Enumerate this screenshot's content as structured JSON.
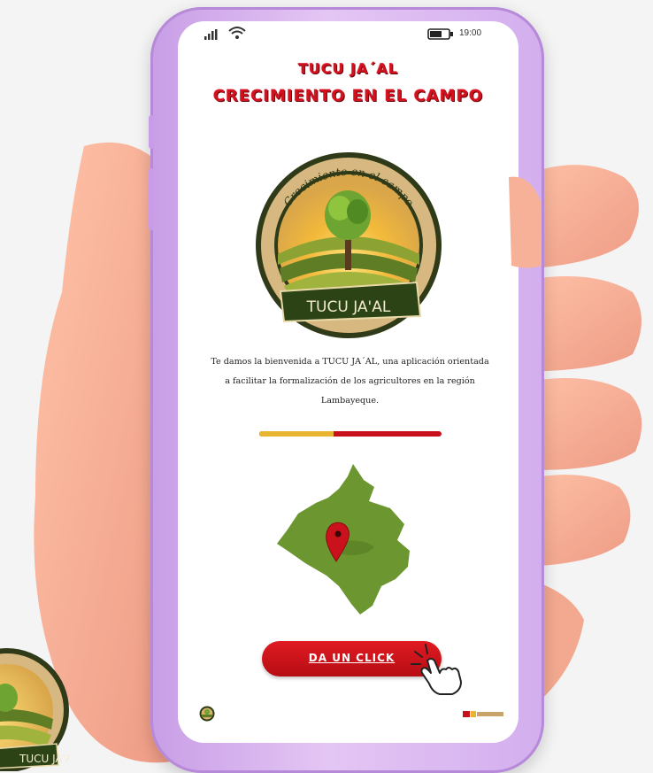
{
  "status_bar": {
    "time": "19:00",
    "icons": [
      "signal-icon",
      "wifi-icon",
      "battery-icon"
    ]
  },
  "header": {
    "line1": "TUCU JA´AL",
    "line2": "CRECIMIENTO EN EL CAMPO"
  },
  "logo": {
    "arc_text": "Crecimiento en el campo",
    "banner_text": "TUCU JA'AL"
  },
  "intro": {
    "line1": "Te damos la bienvenida a TUCU JA´AL, una aplicación orientada",
    "line2": "a facilitar la formalización de los agricultores en la región",
    "line3": "Lambayeque."
  },
  "progress": {
    "value_fraction": 0.41,
    "fill_color": "#e7b530",
    "track_color": "#c8111b"
  },
  "map": {
    "icons": [
      "lambayeque-map",
      "location-pin-icon"
    ],
    "fill_color": "#6b9630"
  },
  "cta": {
    "label": "DA UN CLICK",
    "icon": "pointing-hand-cursor-icon",
    "color": "#d3161e"
  },
  "footer": {
    "icons": [
      "small-logo-icon",
      "institution-logo-icon"
    ]
  },
  "colors": {
    "title_red": "#d1121e",
    "phone_frame": "#d3aeee",
    "olive": "#6b9630"
  }
}
